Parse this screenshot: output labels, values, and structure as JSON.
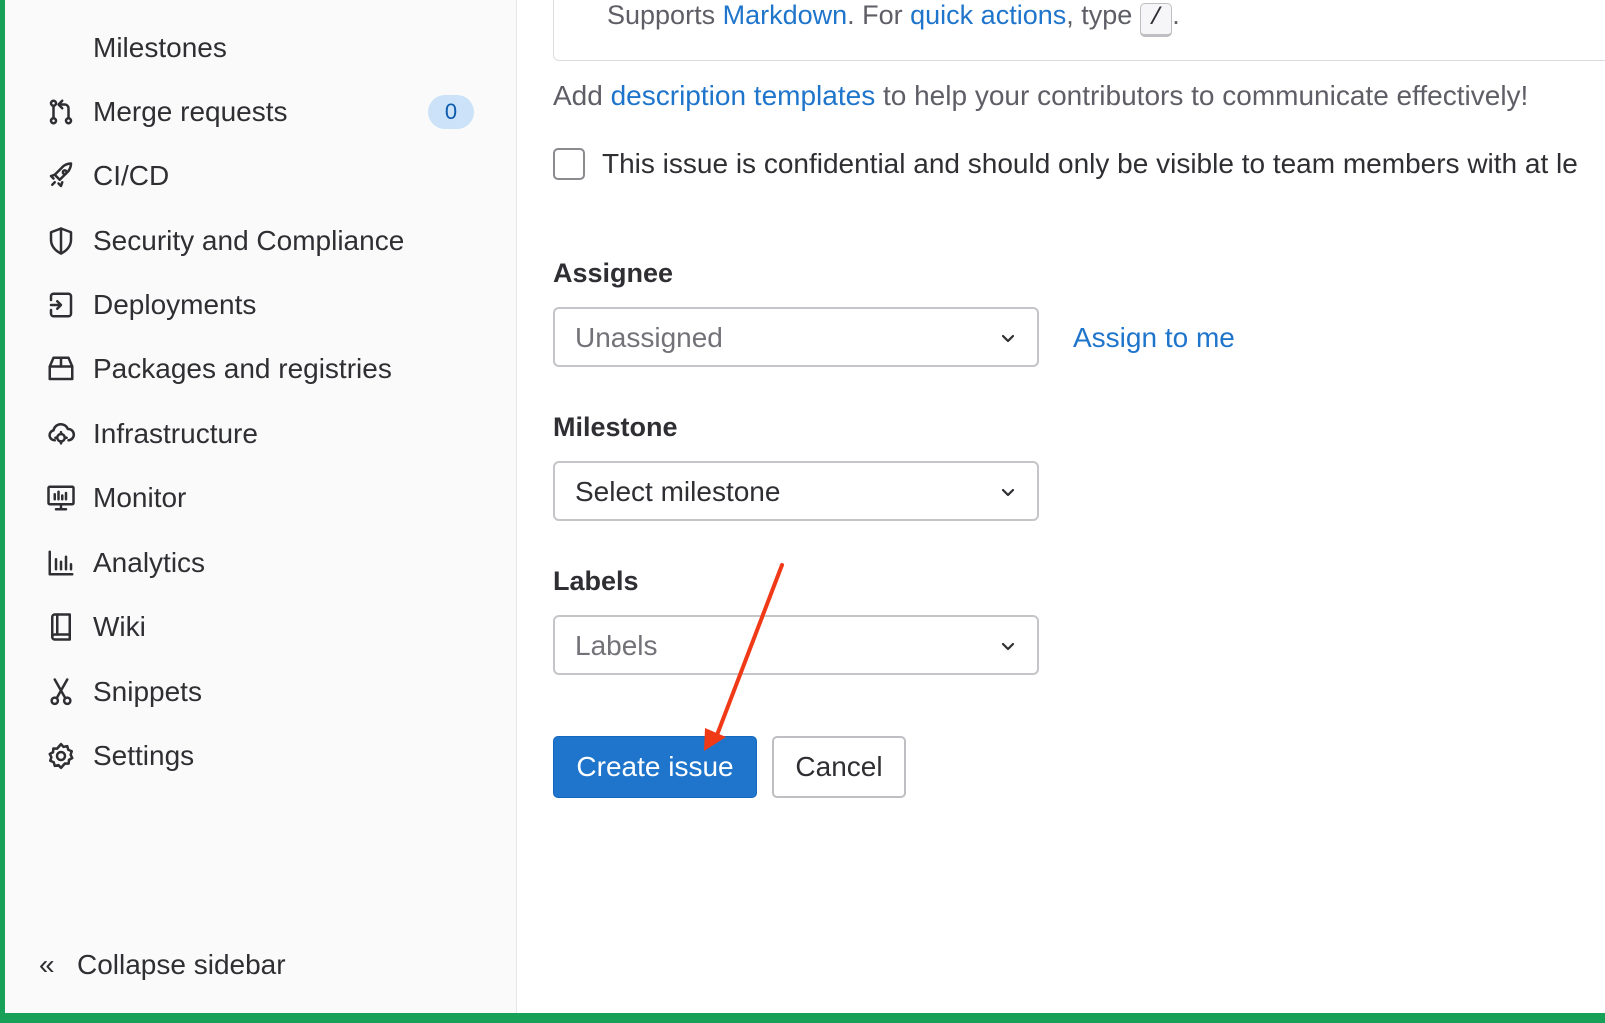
{
  "sidebar": {
    "items": [
      {
        "label": "Milestones",
        "icon": "none"
      },
      {
        "label": "Merge requests",
        "icon": "merge-request-icon",
        "badge": "0"
      },
      {
        "label": "CI/CD",
        "icon": "rocket-icon"
      },
      {
        "label": "Security and Compliance",
        "icon": "shield-icon"
      },
      {
        "label": "Deployments",
        "icon": "deployments-icon"
      },
      {
        "label": "Packages and registries",
        "icon": "package-icon"
      },
      {
        "label": "Infrastructure",
        "icon": "cloud-gear-icon"
      },
      {
        "label": "Monitor",
        "icon": "monitor-icon"
      },
      {
        "label": "Analytics",
        "icon": "analytics-icon"
      },
      {
        "label": "Wiki",
        "icon": "book-icon"
      },
      {
        "label": "Snippets",
        "icon": "scissors-icon"
      },
      {
        "label": "Settings",
        "icon": "gear-icon"
      }
    ],
    "collapse_label": "Collapse sidebar"
  },
  "editor_hint": {
    "prefix": "Supports ",
    "markdown_link": "Markdown",
    "middle": ". For ",
    "quick_actions_link": "quick actions",
    "type_text": ", type ",
    "kbd": "/",
    "suffix": "."
  },
  "templates_hint": {
    "prefix": "Add ",
    "link": "description templates",
    "suffix": " to help your contributors to communicate effectively!"
  },
  "confidential": {
    "label": "This issue is confidential and should only be visible to team members with at le",
    "checked": false
  },
  "assignee": {
    "label": "Assignee",
    "value": "Unassigned",
    "assign_to_me": "Assign to me"
  },
  "milestone": {
    "label": "Milestone",
    "value": "Select milestone"
  },
  "labels": {
    "label": "Labels",
    "value": "Labels"
  },
  "actions": {
    "create": "Create issue",
    "cancel": "Cancel"
  },
  "colors": {
    "accent": "#1f75cb",
    "frame": "#16a058",
    "annotation_arrow": "#f03a17"
  }
}
